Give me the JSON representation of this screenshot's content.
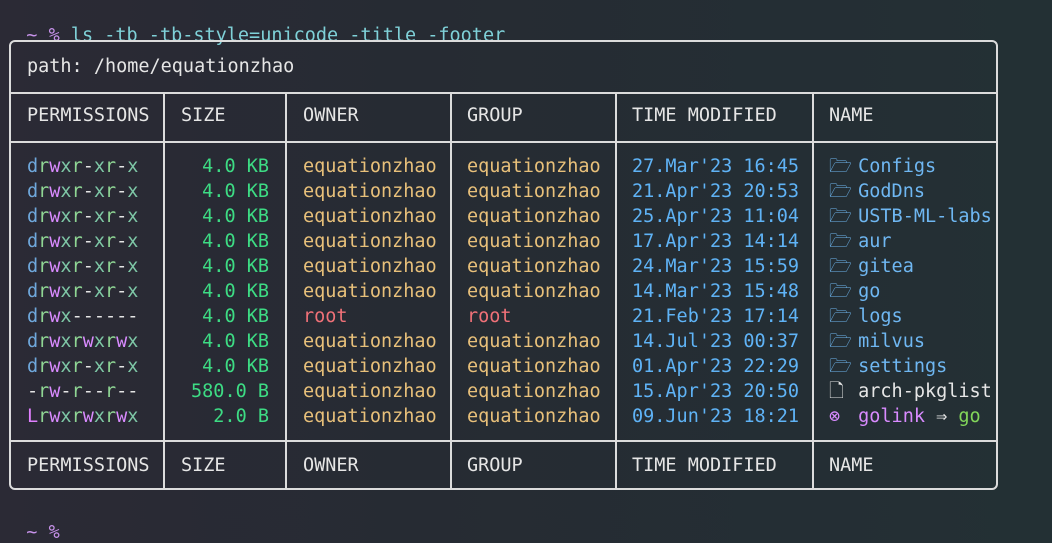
{
  "prompt": {
    "tilde": "~",
    "percent": "%",
    "command": "ls -tb -tb-style=unicode -title -footer"
  },
  "table": {
    "path_label": "path: /home/equationzhao",
    "headers": [
      "PERMISSIONS",
      "SIZE",
      "OWNER",
      "GROUP",
      "TIME MODIFIED",
      "NAME"
    ],
    "rows": [
      {
        "perm": "drwxr-xr-x",
        "size": "4.0 KB",
        "owner": "equationzhao",
        "group": "equationzhao",
        "time": "27.Mar'23 16:45",
        "icon": "folder-icon",
        "name": "Configs"
      },
      {
        "perm": "drwxr-xr-x",
        "size": "4.0 KB",
        "owner": "equationzhao",
        "group": "equationzhao",
        "time": "21.Apr'23 20:53",
        "icon": "folder-icon",
        "name": "GodDns"
      },
      {
        "perm": "drwxr-xr-x",
        "size": "4.0 KB",
        "owner": "equationzhao",
        "group": "equationzhao",
        "time": "25.Apr'23 11:04",
        "icon": "folder-icon",
        "name": "USTB-ML-labs"
      },
      {
        "perm": "drwxr-xr-x",
        "size": "4.0 KB",
        "owner": "equationzhao",
        "group": "equationzhao",
        "time": "17.Apr'23 14:14",
        "icon": "folder-icon",
        "name": "aur"
      },
      {
        "perm": "drwxr-xr-x",
        "size": "4.0 KB",
        "owner": "equationzhao",
        "group": "equationzhao",
        "time": "24.Mar'23 15:59",
        "icon": "folder-icon",
        "name": "gitea"
      },
      {
        "perm": "drwxr-xr-x",
        "size": "4.0 KB",
        "owner": "equationzhao",
        "group": "equationzhao",
        "time": "14.Mar'23 15:48",
        "icon": "folder-icon",
        "name": "go"
      },
      {
        "perm": "drwx------",
        "size": "4.0 KB",
        "owner": "root",
        "group": "root",
        "time": "21.Feb'23 17:14",
        "icon": "folder-icon",
        "name": "logs"
      },
      {
        "perm": "drwxrwxrwx",
        "size": "4.0 KB",
        "owner": "equationzhao",
        "group": "equationzhao",
        "time": "14.Jul'23 00:37",
        "icon": "folder-icon",
        "name": "milvus"
      },
      {
        "perm": "drwxr-xr-x",
        "size": "4.0 KB",
        "owner": "equationzhao",
        "group": "equationzhao",
        "time": "01.Apr'23 22:29",
        "icon": "folder-icon",
        "name": "settings"
      },
      {
        "perm": "-rw-r--r--",
        "size": "580.0 B",
        "owner": "equationzhao",
        "group": "equationzhao",
        "time": "15.Apr'23 20:50",
        "icon": "file-icon",
        "name": "arch-pkglist"
      },
      {
        "perm": "Lrwxrwxrwx",
        "size": "2.0 B",
        "owner": "equationzhao",
        "group": "equationzhao",
        "time": "09.Jun'23 18:21",
        "icon": "link-icon",
        "name": "golink",
        "arrow": "⇒",
        "target": "go"
      }
    ],
    "footers": [
      "PERMISSIONS",
      "SIZE",
      "OWNER",
      "GROUP",
      "TIME MODIFIED",
      "NAME"
    ]
  },
  "colors": {
    "folder": "#6fb7f2",
    "owner": "#e8c07a",
    "root": "#f07178",
    "size": "#3ddc84",
    "time": "#5fb3f6",
    "symlink": "#d98bff",
    "link_target": "#82d65a"
  }
}
